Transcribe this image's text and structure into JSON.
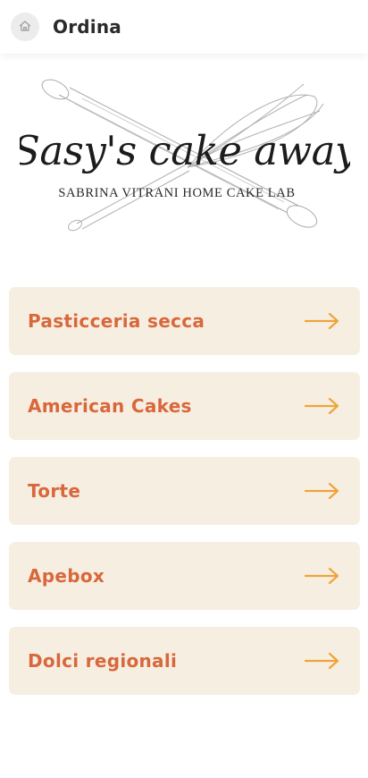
{
  "header": {
    "title": "Ordina",
    "home_icon": "home-icon"
  },
  "logo": {
    "script_text": "Sasy's cake away",
    "tagline": "SABRINA VITRANI HOME CAKE LAB"
  },
  "menu": {
    "items": [
      {
        "label": "Pasticceria secca",
        "icon": "arrow-right-icon"
      },
      {
        "label": "American Cakes",
        "icon": "arrow-right-icon"
      },
      {
        "label": "Torte",
        "icon": "arrow-right-icon"
      },
      {
        "label": "Apebox",
        "icon": "arrow-right-icon"
      },
      {
        "label": "Dolci regionali",
        "icon": "arrow-right-icon"
      }
    ]
  },
  "colors": {
    "item_background": "#f6efe1",
    "item_text": "#d9673c",
    "arrow": "#f0a33c"
  }
}
